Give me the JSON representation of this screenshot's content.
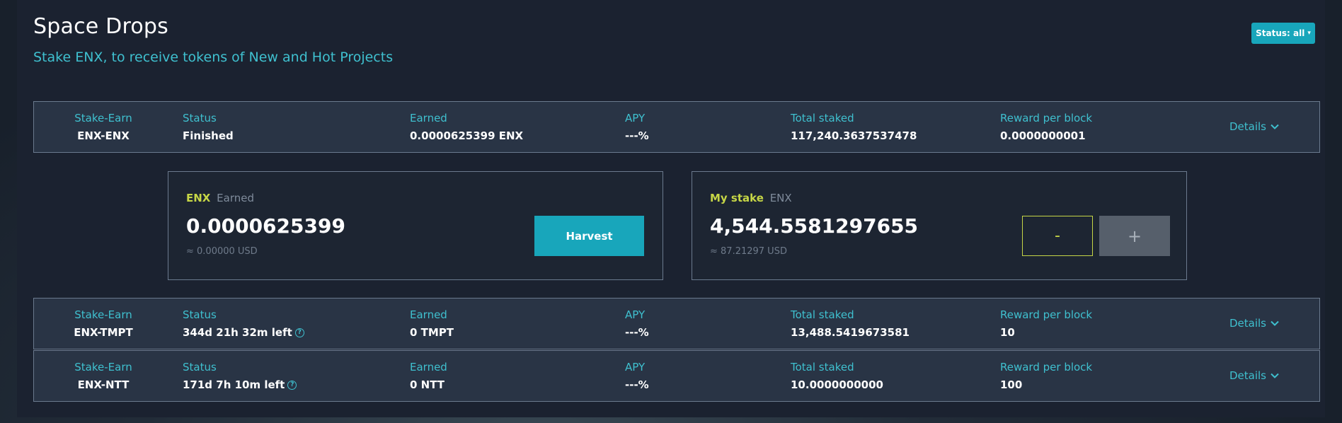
{
  "header": {
    "title": "Space Drops",
    "subtitle": "Stake ENX, to receive tokens of New and Hot Projects",
    "status_filter_label": "Status: all",
    "status_filter_icon": "caret-down-icon"
  },
  "colors": {
    "accent": "#18a6bb",
    "label_teal": "#3fc0cf",
    "highlight_lime": "#c6d646",
    "row_bg": "#293445",
    "page_bg": "#1b2230"
  },
  "pools": [
    {
      "pair_label": "Stake-Earn",
      "pair": "ENX-ENX",
      "status_label": "Status",
      "status": "Finished",
      "status_help": false,
      "earned_label": "Earned",
      "earned": "0.0000625399 ENX",
      "apy_label": "APY",
      "apy": "---%",
      "total_label": "Total staked",
      "total": "117,240.3637537478",
      "reward_label": "Reward per block",
      "reward": "0.0000000001",
      "details": "Details",
      "expanded": true
    },
    {
      "pair_label": "Stake-Earn",
      "pair": "ENX-TMPT",
      "status_label": "Status",
      "status": "344d 21h 32m left",
      "status_help": true,
      "earned_label": "Earned",
      "earned": "0 TMPT",
      "apy_label": "APY",
      "apy": "---%",
      "total_label": "Total staked",
      "total": "13,488.5419673581",
      "reward_label": "Reward per block",
      "reward": "10",
      "details": "Details",
      "expanded": false
    },
    {
      "pair_label": "Stake-Earn",
      "pair": "ENX-NTT",
      "status_label": "Status",
      "status": "171d 7h 10m left",
      "status_help": true,
      "earned_label": "Earned",
      "earned": "0 NTT",
      "apy_label": "APY",
      "apy": "---%",
      "total_label": "Total staked",
      "total": "10.0000000000",
      "reward_label": "Reward per block",
      "reward": "100",
      "details": "Details",
      "expanded": false
    }
  ],
  "expanded": {
    "earned_card": {
      "token": "ENX",
      "label": "Earned",
      "amount": "0.0000625399",
      "usd": "≈ 0.00000 USD",
      "harvest_label": "Harvest"
    },
    "stake_card": {
      "label": "My stake",
      "token": "ENX",
      "amount": "4,544.5581297655",
      "usd": "≈ 87.21297 USD",
      "minus_label": "-",
      "plus_label": "+"
    }
  }
}
